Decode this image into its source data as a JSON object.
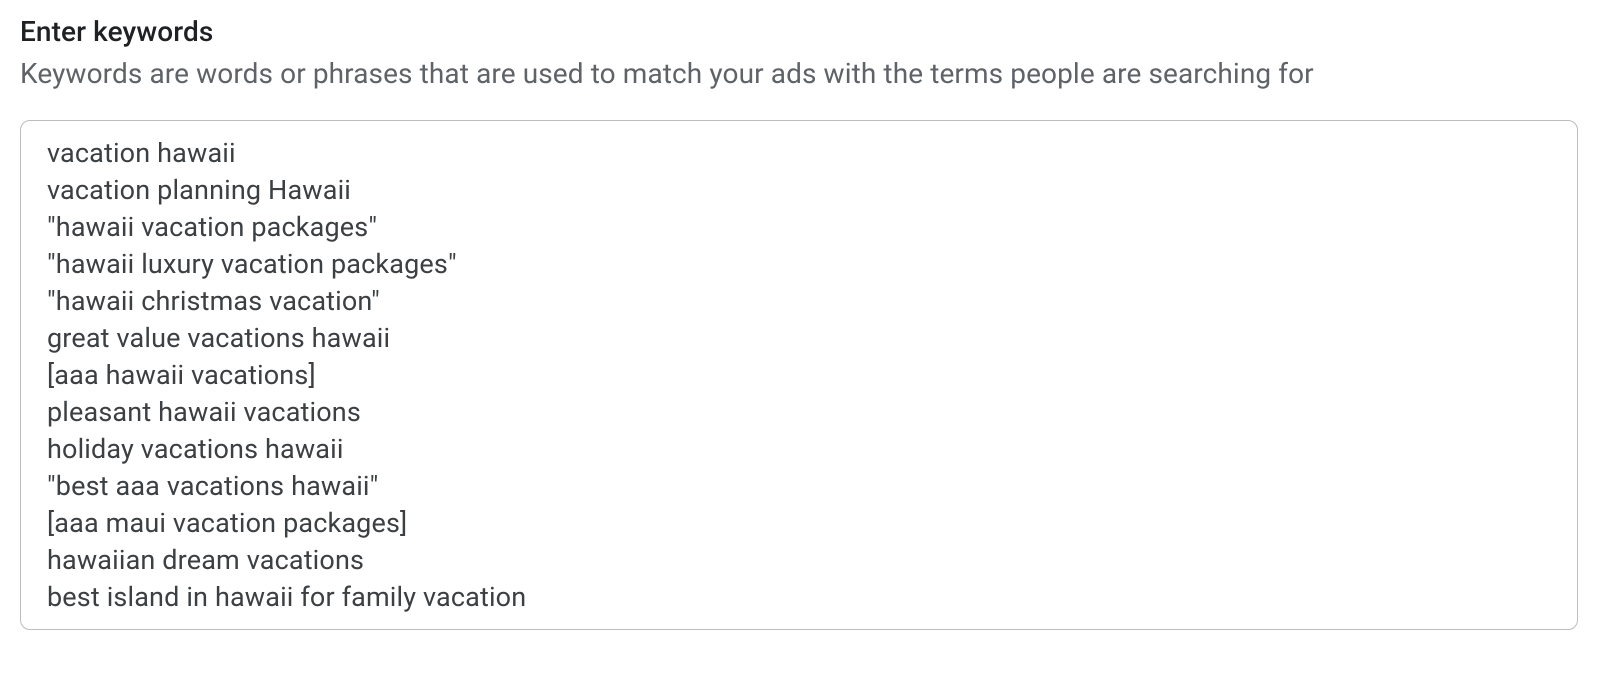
{
  "header": {
    "title": "Enter keywords",
    "subtitle": "Keywords are words or phrases that are used to match your ads with the terms people are searching for"
  },
  "keywords_input": {
    "value": "vacation hawaii\nvacation planning Hawaii\n\"hawaii vacation packages\"\n\"hawaii luxury vacation packages\"\n\"hawaii christmas vacation\"\ngreat value vacations hawaii\n[aaa hawaii vacations]\npleasant hawaii vacations\nholiday vacations hawaii\n\"best aaa vacations hawaii\"\n[aaa maui vacation packages]\nhawaiian dream vacations\nbest island in hawaii for family vacation"
  }
}
